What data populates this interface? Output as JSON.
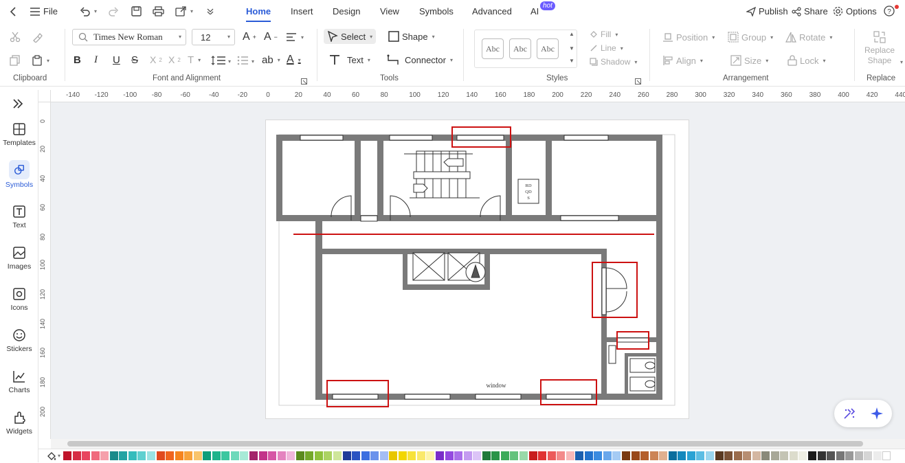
{
  "menubar": {
    "file_label": "File",
    "tabs": [
      {
        "label": "Home"
      },
      {
        "label": "Insert"
      },
      {
        "label": "Design"
      },
      {
        "label": "View"
      },
      {
        "label": "Symbols"
      },
      {
        "label": "Advanced"
      },
      {
        "label": "AI"
      }
    ],
    "ai_badge": "hot",
    "publish_label": "Publish",
    "share_label": "Share",
    "options_label": "Options"
  },
  "ribbon": {
    "groups": {
      "clipboard": "Clipboard",
      "font_alignment": "Font and Alignment",
      "tools": "Tools",
      "styles": "Styles",
      "arrangement": "Arrangement",
      "replace": "Replace"
    },
    "font_name": "Times New Roman",
    "font_size": "12",
    "select_label": "Select",
    "shape_label": "Shape",
    "text_label": "Text",
    "connector_label": "Connector",
    "style_sample": "Abc",
    "fill_label": "Fill",
    "line_label": "Line",
    "shadow_label": "Shadow",
    "position_label": "Position",
    "group_label": "Group",
    "rotate_label": "Rotate",
    "align_label": "Align",
    "size_label": "Size",
    "lock_label": "Lock",
    "replace_shape_label": "Replace Shape"
  },
  "sidebar": {
    "items": [
      {
        "label": "Templates",
        "icon": "templates-icon"
      },
      {
        "label": "Symbols",
        "icon": "symbols-icon"
      },
      {
        "label": "Text",
        "icon": "text-icon"
      },
      {
        "label": "Images",
        "icon": "images-icon"
      },
      {
        "label": "Icons",
        "icon": "icons-icon"
      },
      {
        "label": "Stickers",
        "icon": "stickers-icon"
      },
      {
        "label": "Charts",
        "icon": "charts-icon"
      },
      {
        "label": "Widgets",
        "icon": "widgets-icon"
      }
    ]
  },
  "rulers": {
    "horizontal": [
      "-140",
      "-120",
      "-100",
      "-80",
      "-60",
      "-40",
      "-20",
      "0",
      "20",
      "40",
      "60",
      "80",
      "100",
      "120",
      "140",
      "160",
      "180",
      "200",
      "220",
      "240",
      "260",
      "280",
      "300",
      "320",
      "340",
      "360",
      "380",
      "400",
      "420",
      "440"
    ],
    "vertical": [
      "0",
      "20",
      "40",
      "60",
      "80",
      "100",
      "120",
      "140",
      "160",
      "180",
      "200"
    ]
  },
  "floorplan": {
    "elevator_label": "RD QD S",
    "window_label": "window"
  },
  "colors": {
    "accent": "#2a5bd7",
    "wall": "#7a7a7a",
    "highlight": "#cc1111",
    "palette": [
      "#c0142b",
      "#d62d45",
      "#e8455e",
      "#f06a7d",
      "#f5a0ab",
      "#1a8a8a",
      "#22a3a3",
      "#34bcbc",
      "#5fd0d0",
      "#9be3e3",
      "#e04a1e",
      "#f0651f",
      "#f5841f",
      "#f7a23b",
      "#f9c46b",
      "#0e9e7a",
      "#1fb48b",
      "#3cc7a0",
      "#6dd9bb",
      "#a8ead7",
      "#a3246b",
      "#c2338a",
      "#d655a5",
      "#e483bf",
      "#f0b6da",
      "#5b8a1e",
      "#74a82a",
      "#8fc13c",
      "#acd362",
      "#cfe69a",
      "#1e3c99",
      "#2a53c2",
      "#3b6ee0",
      "#6a92ec",
      "#a4bdf4",
      "#e8c600",
      "#f2d600",
      "#f7e23a",
      "#fae96b",
      "#fdf4a8",
      "#7a2dc9",
      "#9449e0",
      "#ab6fea",
      "#c49bf1",
      "#dcc4f7",
      "#1f7a3a",
      "#2a9448",
      "#3dab5b",
      "#63c27c",
      "#9ad9a9",
      "#c81e1e",
      "#e03232",
      "#ec5a5a",
      "#f38a8a",
      "#f8b8b8",
      "#1b5fae",
      "#2272cc",
      "#3a8be0",
      "#6aa8ec",
      "#a5cbf4",
      "#7a3a12",
      "#99481a",
      "#b45f2c",
      "#cc8456",
      "#e0b08f",
      "#0b6e9e",
      "#1488bd",
      "#2aa2d4",
      "#5cbde3",
      "#9ad6ef",
      "#5a3a22",
      "#7a5236",
      "#9a6c4c",
      "#b78e72",
      "#d4b7a2",
      "#8a8a7a",
      "#a8a898",
      "#c4c4b4",
      "#dcdccc",
      "#efefe4",
      "#1a1a1a",
      "#333333",
      "#555555",
      "#777777",
      "#999999",
      "#bbbbbb",
      "#d5d5d5",
      "#ececec",
      "#ffffff"
    ]
  }
}
